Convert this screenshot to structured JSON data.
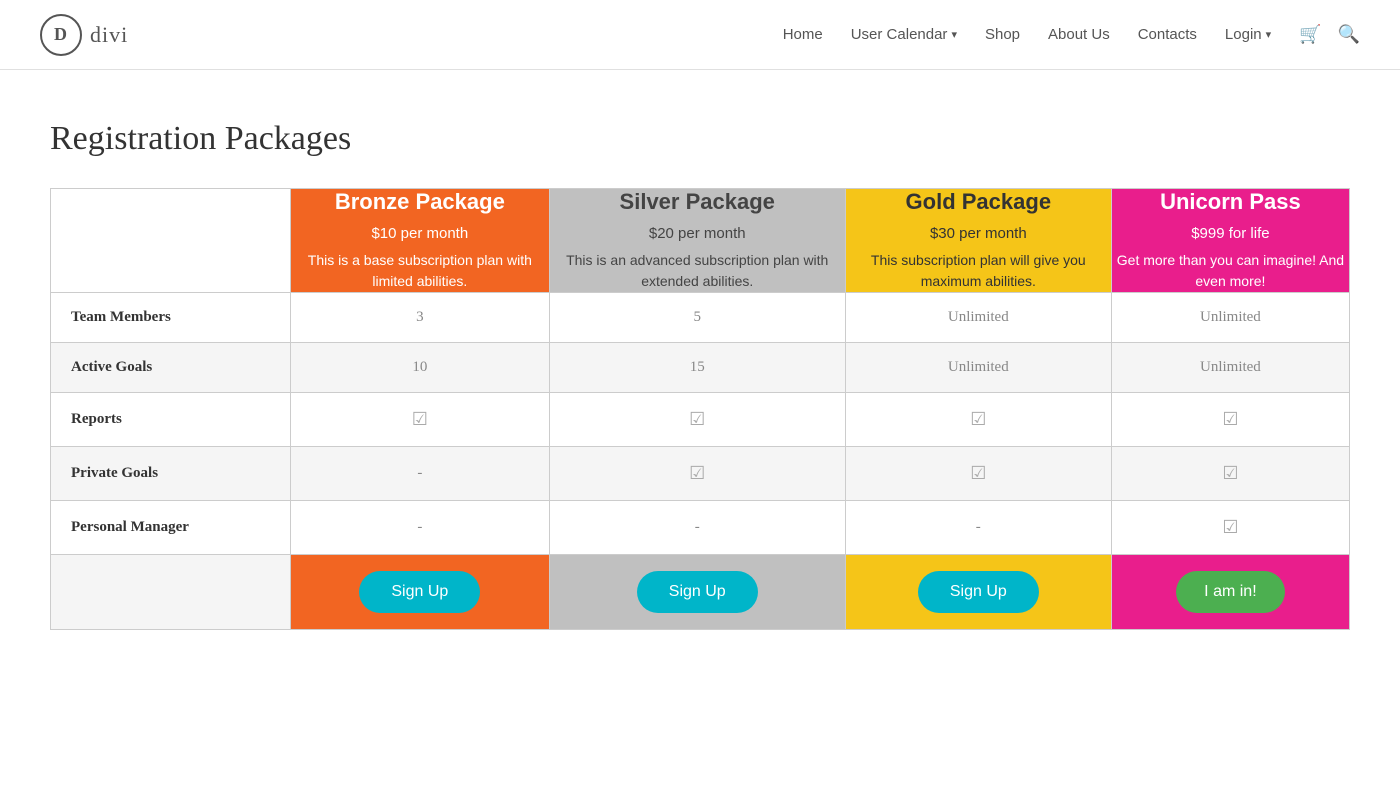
{
  "logo": {
    "letter": "D",
    "brand": "divi"
  },
  "nav": {
    "items": [
      {
        "label": "Home",
        "hasDropdown": false
      },
      {
        "label": "User Calendar",
        "hasDropdown": true
      },
      {
        "label": "Shop",
        "hasDropdown": false
      },
      {
        "label": "About Us",
        "hasDropdown": false
      },
      {
        "label": "Contacts",
        "hasDropdown": false
      },
      {
        "label": "Login",
        "hasDropdown": true
      }
    ]
  },
  "page": {
    "title": "Registration Packages"
  },
  "packages": [
    {
      "id": "bronze",
      "name": "Bronze Package",
      "price": "$10 per month",
      "description": "This is a base subscription plan with limited abilities.",
      "colorClass": "bronze",
      "btnClass": "btn-bronze",
      "btnLabel": "Sign Up",
      "btnType": "signup"
    },
    {
      "id": "silver",
      "name": "Silver Package",
      "price": "$20 per month",
      "description": "This is an advanced subscription plan with extended abilities.",
      "colorClass": "silver",
      "btnClass": "btn-silver",
      "btnLabel": "Sign Up",
      "btnType": "signup"
    },
    {
      "id": "gold",
      "name": "Gold Package",
      "price": "$30 per month",
      "description": "This subscription plan will give you maximum abilities.",
      "colorClass": "gold",
      "btnClass": "btn-gold",
      "btnLabel": "Sign Up",
      "btnType": "signup"
    },
    {
      "id": "unicorn",
      "name": "Unicorn Pass",
      "price": "$999 for life",
      "description": "Get more than you can imagine! And even more!",
      "colorClass": "unicorn",
      "btnClass": "btn-unicorn",
      "btnLabel": "I am in!",
      "btnType": "iamin"
    }
  ],
  "features": [
    {
      "label": "Team Members",
      "values": [
        "3",
        "5",
        "Unlimited",
        "Unlimited"
      ],
      "type": "text"
    },
    {
      "label": "Active Goals",
      "values": [
        "10",
        "15",
        "Unlimited",
        "Unlimited"
      ],
      "type": "text"
    },
    {
      "label": "Reports",
      "values": [
        "check",
        "check",
        "check",
        "check"
      ],
      "type": "check"
    },
    {
      "label": "Private Goals",
      "values": [
        "-",
        "check",
        "check",
        "check"
      ],
      "type": "mixed"
    },
    {
      "label": "Personal Manager",
      "values": [
        "-",
        "-",
        "-",
        "check"
      ],
      "type": "mixed"
    }
  ],
  "checkmark": "☑"
}
